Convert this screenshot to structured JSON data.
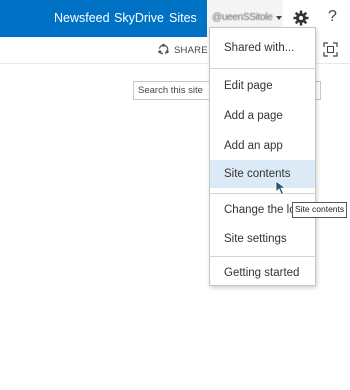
{
  "suitebar": {
    "links": [
      "Newsfeed",
      "SkyDrive",
      "Sites"
    ],
    "user_name": "@ueenSSitole",
    "gear_icon": "gear-icon",
    "help_label": "?"
  },
  "ribbon": {
    "share_label": "SHARE",
    "share_icon": "share-icon",
    "focus_icon": "focus-on-content-icon"
  },
  "search": {
    "placeholder": "Search this site"
  },
  "menu": {
    "items": [
      {
        "label": "Shared with..."
      },
      {
        "label": "Edit page"
      },
      {
        "label": "Add a page"
      },
      {
        "label": "Add an app"
      },
      {
        "label": "Site contents"
      },
      {
        "label": "Change the look"
      },
      {
        "label": "Site settings"
      },
      {
        "label": "Getting started"
      }
    ],
    "highlighted_item": "Site contents"
  },
  "tooltip": {
    "text": "Site contents"
  },
  "colors": {
    "suitebar": "#0072c6",
    "highlight": "#dbeaf6",
    "cursor": "#1d5a6e"
  }
}
